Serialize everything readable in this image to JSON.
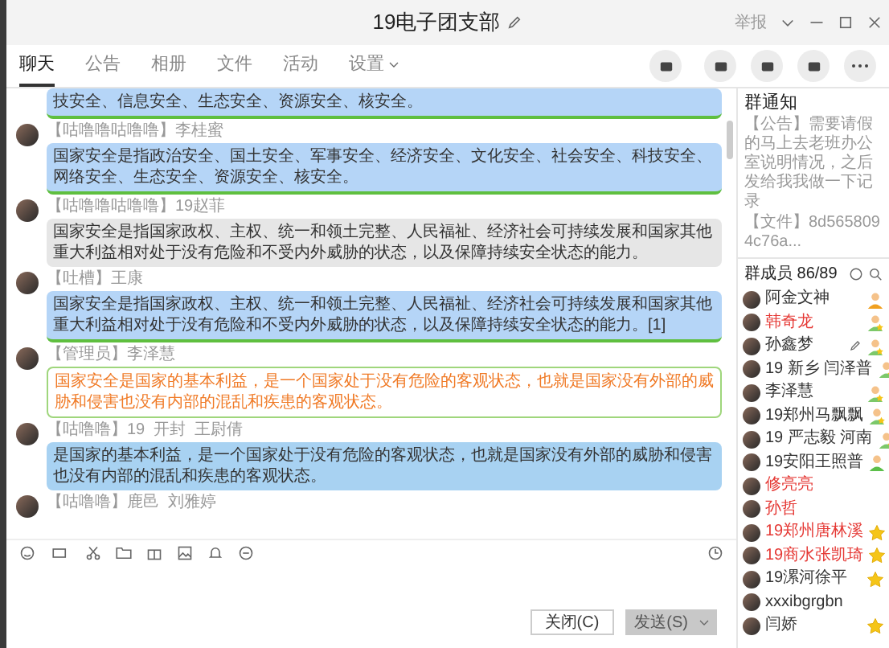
{
  "window": {
    "title": "19电子团支部",
    "report": "举报"
  },
  "tabs": [
    {
      "label": "聊天",
      "selected": true
    },
    {
      "label": "公告",
      "selected": false
    },
    {
      "label": "相册",
      "selected": false
    },
    {
      "label": "文件",
      "selected": false
    },
    {
      "label": "活动",
      "selected": false
    },
    {
      "label": "设置",
      "selected": false,
      "dropdown": true
    }
  ],
  "messages": [
    {
      "kind": "fancy",
      "text": "技安全、信息安全、生态安全、资源安全、核安全。"
    },
    {
      "tag": "【咕噜噜咕噜噜】",
      "name": "李桂蜜",
      "kind": "fancy",
      "text": "国家安全是指政治安全、国土安全、军事安全、经济安全、文化安全、社会安全、科技安全、网络安全、生态安全、资源安全、核安全。"
    },
    {
      "tag": "【咕噜噜咕噜噜】",
      "name": "19赵菲",
      "kind": "gray",
      "text": "国家安全是指国家政权、主权、统一和领土完整、人民福祉、经济社会可持续发展和国家其他重大利益相对处于没有危险和不受内外威胁的状态，以及保障持续安全状态的能力。"
    },
    {
      "tag": "【吐槽】",
      "name": "王康",
      "kind": "fancy",
      "text": "国家安全是指国家政权、主权、统一和领土完整、人民福祉、经济社会可持续发展和国家其他重大利益相对处于没有危险和不受内外威胁的状态，以及保障持续安全状态的能力。[1]"
    },
    {
      "tag": "【管理员】",
      "name": "李泽慧",
      "kind": "outlined",
      "text": "国家安全是国家的基本利益，是一个国家处于没有危险的客观状态，也就是国家没有外部的威胁和侵害也没有内部的混乱和疾患的客观状态。"
    },
    {
      "tag": "【咕噜噜】",
      "name": "19  开封  王尉倩",
      "kind": "sky",
      "text": "是国家的基本利益，是一个国家处于没有危险的客观状态，也就是国家没有外部的威胁和侵害也没有内部的混乱和疾患的客观状态。"
    },
    {
      "tag": "【咕噜噜】",
      "name": "鹿邑  刘雅婷",
      "kind": "none"
    }
  ],
  "buttons": {
    "close": "关闭(C)",
    "send": "发送(S)"
  },
  "notice": {
    "title": "群通知",
    "announcement": "【公告】需要请假的马上去老班办公室说明情况，之后发给我我做一下记录",
    "file": "【文件】8d5658094c76a..."
  },
  "members": {
    "title": "群成员 86/89",
    "list": [
      {
        "name": "阿金文神",
        "color": "#333333",
        "kind": "owner"
      },
      {
        "name": "韩奇龙",
        "color": "#e53935",
        "kind": "admin"
      },
      {
        "name": "孙鑫梦",
        "color": "#333333",
        "kind": "admin",
        "editable": true
      },
      {
        "name": "19 新乡 闫泽普",
        "color": "#333333",
        "kind": "admin"
      },
      {
        "name": "李泽慧",
        "color": "#333333",
        "kind": "admin"
      },
      {
        "name": "19郑州马飘飘",
        "color": "#333333",
        "kind": "admin"
      },
      {
        "name": "19 严志毅 河南",
        "color": "#333333",
        "kind": "admin"
      },
      {
        "name": "19安阳王照普",
        "color": "#333333",
        "kind": "plain"
      },
      {
        "name": "修亮亮",
        "color": "#e53935",
        "kind": "none"
      },
      {
        "name": "孙哲",
        "color": "#e53935",
        "kind": "none"
      },
      {
        "name": "19郑州唐林溪",
        "color": "#e53935",
        "kind": "star"
      },
      {
        "name": "19商水张凯琦",
        "color": "#e53935",
        "kind": "star"
      },
      {
        "name": "19漯河徐平",
        "color": "#333333",
        "kind": "star"
      },
      {
        "name": "xxxibgrgbn",
        "color": "#333333",
        "kind": "none"
      },
      {
        "name": "闫娇",
        "color": "#333333",
        "kind": "star"
      }
    ]
  }
}
